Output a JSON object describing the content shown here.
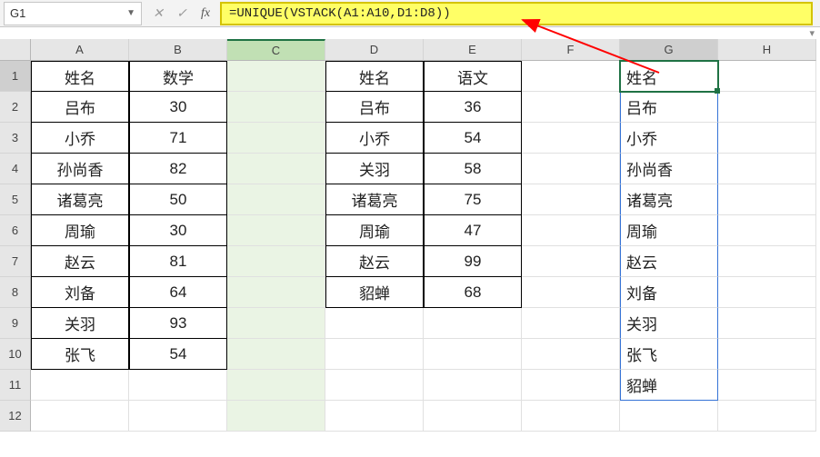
{
  "formula_bar": {
    "cell_ref": "G1",
    "formula": "=UNIQUE(VSTACK(A1:A10,D1:D8))"
  },
  "columns": [
    "A",
    "B",
    "C",
    "D",
    "E",
    "F",
    "G",
    "H"
  ],
  "rows": [
    "1",
    "2",
    "3",
    "4",
    "5",
    "6",
    "7",
    "8",
    "9",
    "10",
    "11",
    "12"
  ],
  "tableAB": {
    "header": {
      "name": "姓名",
      "score": "数学"
    },
    "rows": [
      {
        "name": "吕布",
        "score": "30"
      },
      {
        "name": "小乔",
        "score": "71"
      },
      {
        "name": "孙尚香",
        "score": "82"
      },
      {
        "name": "诸葛亮",
        "score": "50"
      },
      {
        "name": "周瑜",
        "score": "30"
      },
      {
        "name": "赵云",
        "score": "81"
      },
      {
        "name": "刘备",
        "score": "64"
      },
      {
        "name": "关羽",
        "score": "93"
      },
      {
        "name": "张飞",
        "score": "54"
      }
    ]
  },
  "tableDE": {
    "header": {
      "name": "姓名",
      "score": "语文"
    },
    "rows": [
      {
        "name": "吕布",
        "score": "36"
      },
      {
        "name": "小乔",
        "score": "54"
      },
      {
        "name": "关羽",
        "score": "58"
      },
      {
        "name": "诸葛亮",
        "score": "75"
      },
      {
        "name": "周瑜",
        "score": "47"
      },
      {
        "name": "赵云",
        "score": "99"
      },
      {
        "name": "貂蝉",
        "score": "68"
      }
    ]
  },
  "result_G": [
    "姓名",
    "吕布",
    "小乔",
    "孙尚香",
    "诸葛亮",
    "周瑜",
    "赵云",
    "刘备",
    "关羽",
    "张飞",
    "貂蝉"
  ],
  "chart_data": {
    "type": "table",
    "note": "Spreadsheet demonstrating =UNIQUE(VSTACK(A1:A10,D1:D8)) producing merged unique name list in G1:G11",
    "tables": [
      {
        "range": "A1:B10",
        "columns": [
          "姓名",
          "数学"
        ],
        "rows": [
          [
            "吕布",
            30
          ],
          [
            "小乔",
            71
          ],
          [
            "孙尚香",
            82
          ],
          [
            "诸葛亮",
            50
          ],
          [
            "周瑜",
            30
          ],
          [
            "赵云",
            81
          ],
          [
            "刘备",
            64
          ],
          [
            "关羽",
            93
          ],
          [
            "张飞",
            54
          ]
        ]
      },
      {
        "range": "D1:E8",
        "columns": [
          "姓名",
          "语文"
        ],
        "rows": [
          [
            "吕布",
            36
          ],
          [
            "小乔",
            54
          ],
          [
            "关羽",
            58
          ],
          [
            "诸葛亮",
            75
          ],
          [
            "周瑜",
            47
          ],
          [
            "赵云",
            99
          ],
          [
            "貂蝉",
            68
          ]
        ]
      }
    ],
    "formula_cell": "G1",
    "formula": "=UNIQUE(VSTACK(A1:A10,D1:D8))",
    "result": [
      "姓名",
      "吕布",
      "小乔",
      "孙尚香",
      "诸葛亮",
      "周瑜",
      "赵云",
      "刘备",
      "关羽",
      "张飞",
      "貂蝉"
    ]
  }
}
